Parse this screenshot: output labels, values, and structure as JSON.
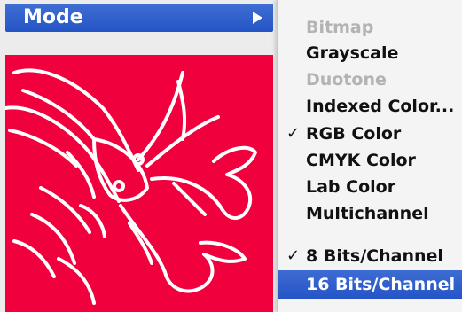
{
  "parent_menu": {
    "mode_label": "Mode"
  },
  "submenu": {
    "items": [
      {
        "label": "Bitmap",
        "enabled": false,
        "checked": false
      },
      {
        "label": "Grayscale",
        "enabled": true,
        "checked": false
      },
      {
        "label": "Duotone",
        "enabled": false,
        "checked": false
      },
      {
        "label": "Indexed Color...",
        "enabled": true,
        "checked": false
      },
      {
        "label": "RGB Color",
        "enabled": true,
        "checked": true
      },
      {
        "label": "CMYK Color",
        "enabled": true,
        "checked": false
      },
      {
        "label": "Lab Color",
        "enabled": true,
        "checked": false
      },
      {
        "label": "Multichannel",
        "enabled": true,
        "checked": false
      },
      {
        "label": "8 Bits/Channel",
        "enabled": true,
        "checked": true
      },
      {
        "label": "16 Bits/Channel",
        "enabled": true,
        "checked": false,
        "highlighted": true
      }
    ],
    "checkmark": "✓"
  },
  "colors": {
    "highlight": "#2554c7",
    "image_background": "#f0003c",
    "disabled_text": "#b3b3b3"
  },
  "icons": {
    "submenu_arrow": "submenu-arrow-icon",
    "checkmark": "checkmark-icon"
  }
}
